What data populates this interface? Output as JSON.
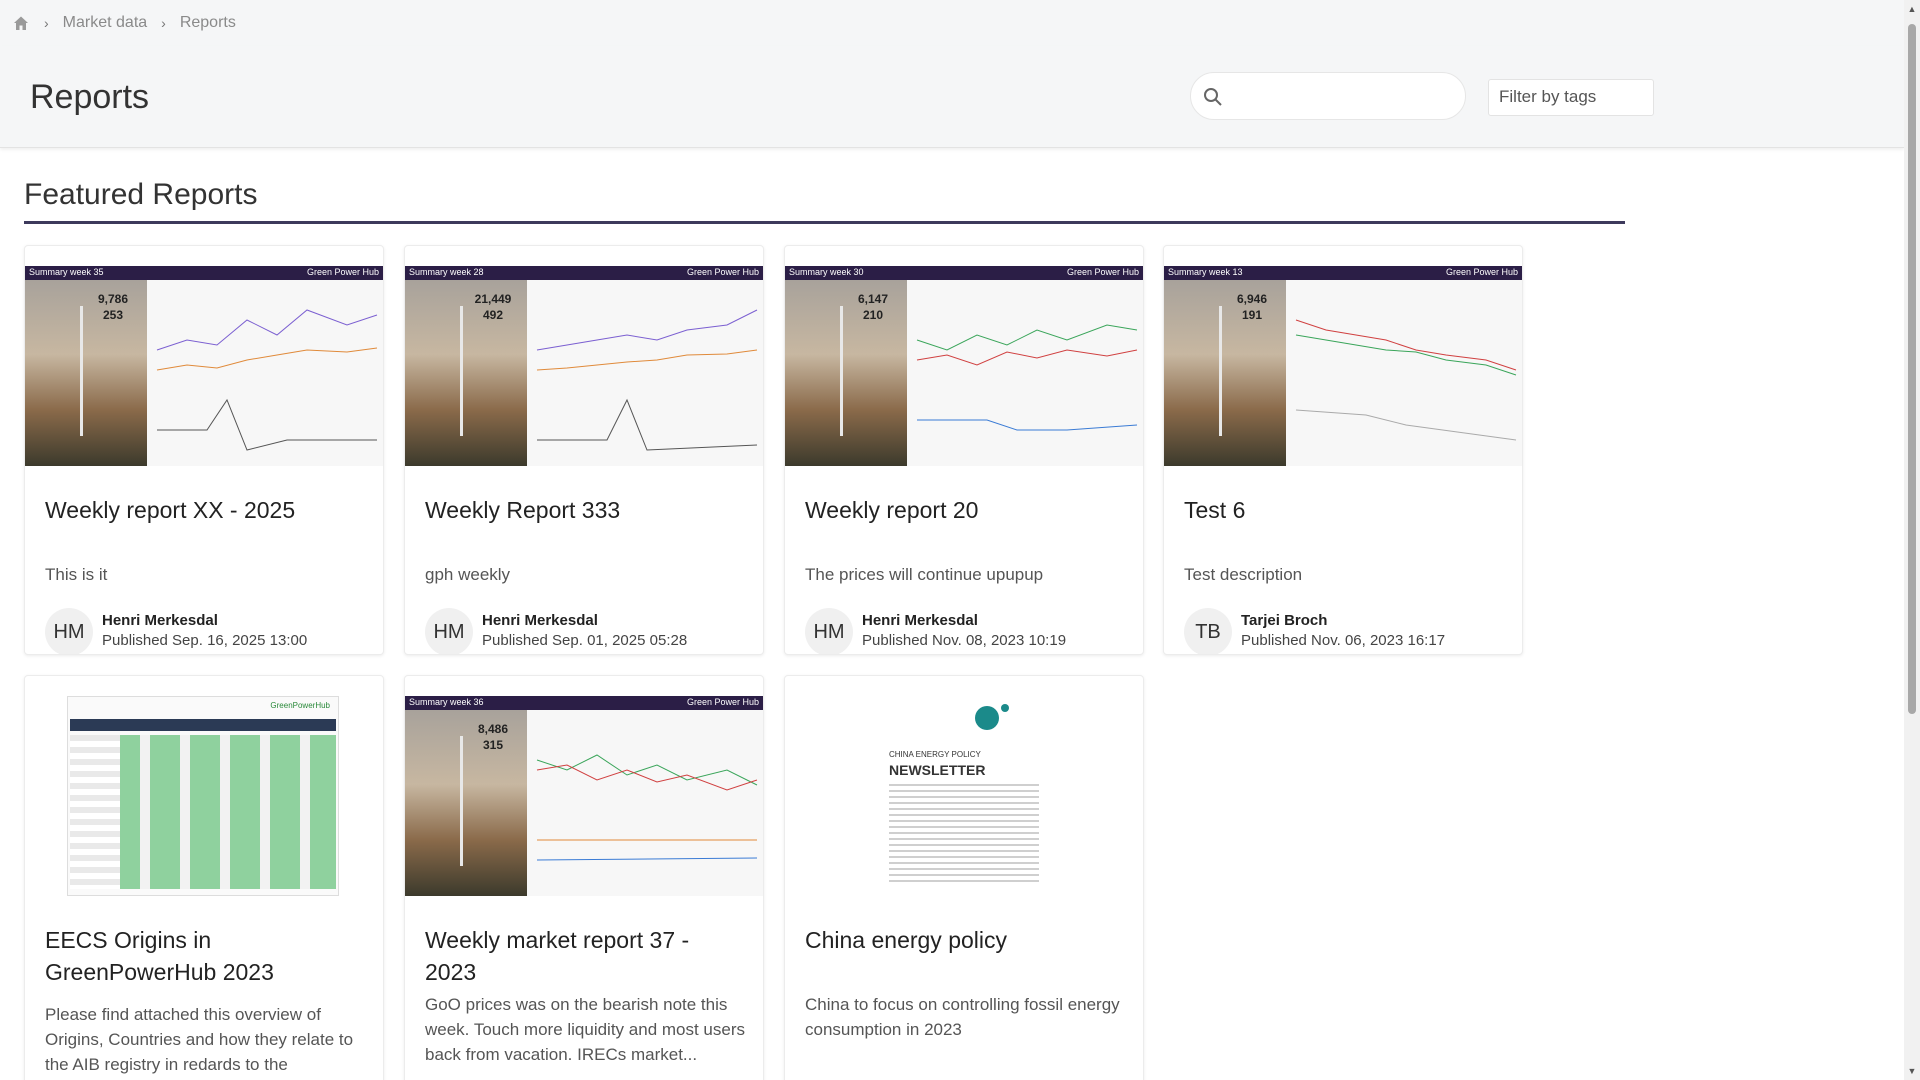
{
  "breadcrumb": {
    "items": [
      "Market data",
      "Reports"
    ]
  },
  "header": {
    "title": "Reports",
    "search_placeholder": "",
    "filter_label": "Filter by tags"
  },
  "section": {
    "title": "Featured Reports"
  },
  "cards": [
    {
      "title": "Weekly report XX - 2025",
      "description": "This is it",
      "initials": "HM",
      "author": "Henri Merkesdal",
      "published": "Published Sep. 16, 2025 13:00",
      "thumb_label": "Summary week 35",
      "thumb_brand": "Green Power Hub",
      "stat_main": "9,786",
      "stat_sub": "253"
    },
    {
      "title": "Weekly Report 333",
      "description": "gph weekly",
      "initials": "HM",
      "author": "Henri Merkesdal",
      "published": "Published Sep. 01, 2025 05:28",
      "thumb_label": "Summary week 28",
      "thumb_brand": "Green Power Hub",
      "stat_main": "21,449",
      "stat_sub": "492"
    },
    {
      "title": "Weekly report 20",
      "description": "The prices will continue upupup",
      "initials": "HM",
      "author": "Henri Merkesdal",
      "published": "Published Nov. 08, 2023 10:19",
      "thumb_label": "Summary week 30",
      "thumb_brand": "Green Power Hub",
      "stat_main": "6,147",
      "stat_sub": "210"
    },
    {
      "title": "Test 6",
      "description": "Test description",
      "initials": "TB",
      "author": "Tarjei Broch",
      "published": "Published Nov. 06, 2023 16:17",
      "thumb_label": "Summary week 13",
      "thumb_brand": "Green Power Hub",
      "stat_main": "6,946",
      "stat_sub": "191"
    },
    {
      "title": "EECS Origins in GreenPowerHub 2023",
      "description": "Please find attached this overview of Origins, Countries and how they relate to the AIB registry in redards to the Europea...",
      "thumb_brand": "GreenPowerHub"
    },
    {
      "title": "Weekly market report 37 - 2023",
      "description": "GoO prices was on the bearish note this week. Touch more liquidity and most users back from vacation. IRECs market...",
      "thumb_label": "Summary week 36",
      "thumb_brand": "Green Power Hub",
      "stat_main": "8,486",
      "stat_sub": "315"
    },
    {
      "title": "China energy policy",
      "description": "China to focus on controlling fossil energy consumption in 2023",
      "thumb_heading": "CHINA ENERGY POLICY",
      "thumb_title": "NEWSLETTER"
    }
  ]
}
